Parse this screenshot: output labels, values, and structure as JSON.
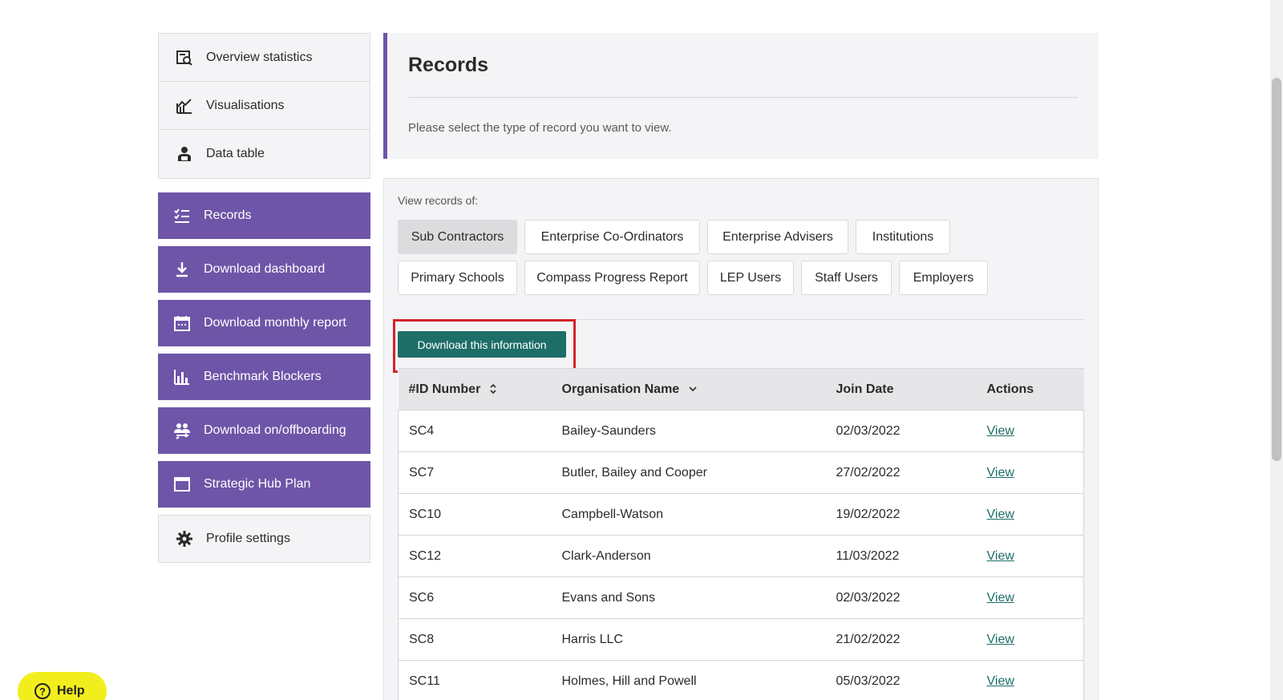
{
  "sidebar": {
    "top_items": [
      {
        "label": "Overview statistics",
        "icon": "search-chart-icon"
      },
      {
        "label": "Visualisations",
        "icon": "line-chart-icon"
      },
      {
        "label": "Data table",
        "icon": "user-table-icon"
      }
    ],
    "purple_items": [
      {
        "label": "Records",
        "icon": "checklist-icon"
      },
      {
        "label": "Download dashboard",
        "icon": "download-icon"
      },
      {
        "label": "Download monthly report",
        "icon": "calendar-icon"
      },
      {
        "label": "Benchmark Blockers",
        "icon": "bar-chart-icon"
      },
      {
        "label": "Download on/offboarding",
        "icon": "users-transfer-icon"
      },
      {
        "label": "Strategic Hub Plan",
        "icon": "window-icon"
      }
    ],
    "profile": {
      "label": "Profile settings",
      "icon": "gear-icon"
    }
  },
  "header": {
    "title": "Records",
    "subtitle": "Please select the type of record you want to view."
  },
  "records": {
    "view_label": "View records of:",
    "record_types": [
      "Sub Contractors",
      "Enterprise Co-Ordinators",
      "Enterprise Advisers",
      "Institutions",
      "Primary Schools",
      "Compass Progress Report",
      "LEP Users",
      "Staff Users",
      "Employers"
    ],
    "active_type": "Sub Contractors",
    "download_button": "Download this information",
    "table": {
      "columns": [
        "#ID Number",
        "Organisation Name",
        "Join Date",
        "Actions"
      ],
      "rows": [
        {
          "id": "SC4",
          "name": "Bailey-Saunders",
          "date": "02/03/2022",
          "action": "View"
        },
        {
          "id": "SC7",
          "name": "Butler, Bailey and Cooper",
          "date": "27/02/2022",
          "action": "View"
        },
        {
          "id": "SC10",
          "name": "Campbell-Watson",
          "date": "19/02/2022",
          "action": "View"
        },
        {
          "id": "SC12",
          "name": "Clark-Anderson",
          "date": "11/03/2022",
          "action": "View"
        },
        {
          "id": "SC6",
          "name": "Evans and Sons",
          "date": "02/03/2022",
          "action": "View"
        },
        {
          "id": "SC8",
          "name": "Harris LLC",
          "date": "21/02/2022",
          "action": "View"
        },
        {
          "id": "SC11",
          "name": "Holmes, Hill and Powell",
          "date": "05/03/2022",
          "action": "View"
        }
      ]
    }
  },
  "help": {
    "label": "Help"
  },
  "colors": {
    "accent": "#6e55a8",
    "button": "#1e6e68",
    "highlight": "#d3232e",
    "help": "#f2ee1e"
  }
}
